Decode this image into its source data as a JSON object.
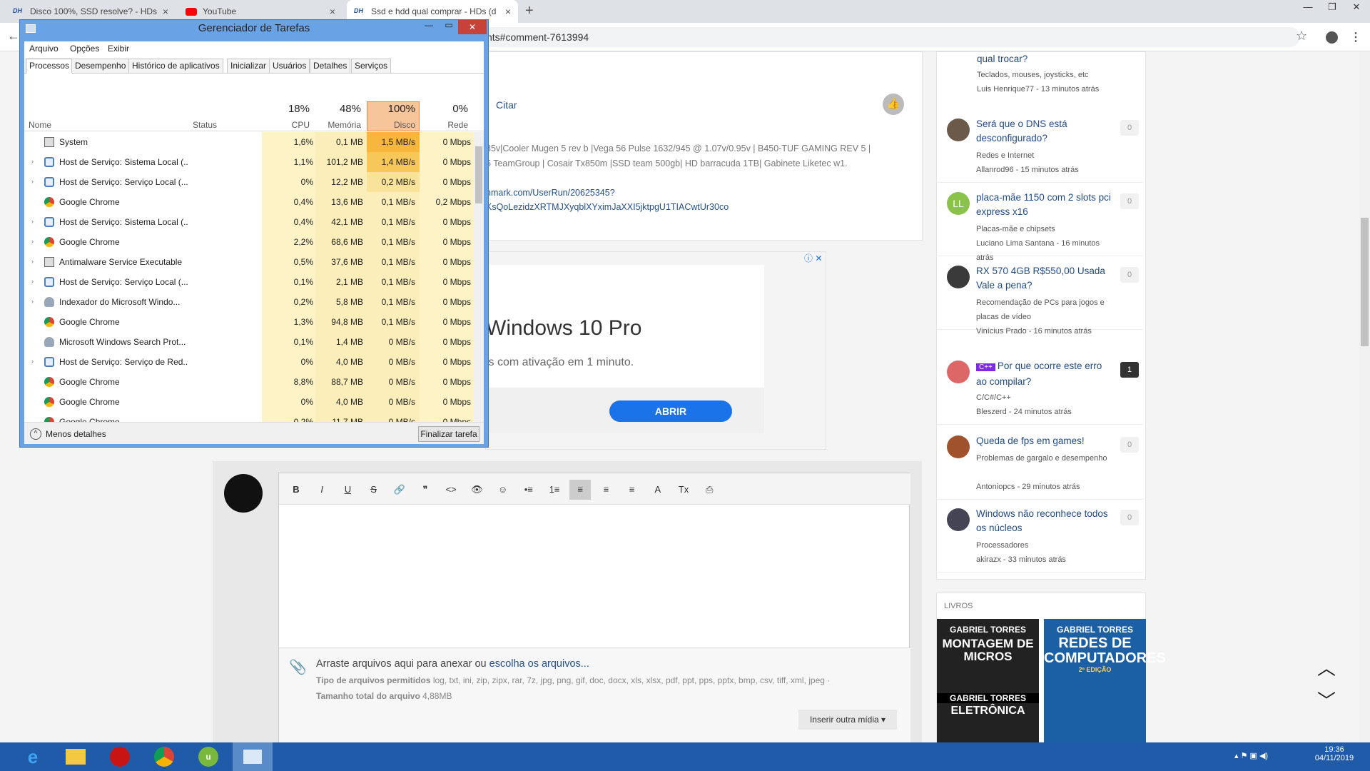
{
  "browser": {
    "tabs": [
      {
        "favicon": "DH",
        "title": "Disco 100%, SSD resolve? - HDs (",
        "close": "×"
      },
      {
        "favicon": "youtube-icon",
        "title": "YouTube",
        "close": "×"
      },
      {
        "favicon": "DH",
        "title": "Ssd e hdd qual comprar - HDs (d",
        "close": "×"
      }
    ],
    "new_tab": "+",
    "url": "nts#comment-7613994",
    "back": "←",
    "star": "☆",
    "menu": "⋮",
    "window_controls": [
      "—",
      "❐",
      "✕"
    ]
  },
  "post": {
    "cite": "Citar",
    "sig_line1": "35v|Cooler Mugen 5 rev b |Vega 56 Pulse 1632/945 @ 1.07v/0.95v | B450-TUF GAMING REV 5 |",
    "sig_line2": "5 TeamGroup | Cosair Tx850m |SSD team 500gb| HD barracuda 1TB| Gabinete Liketec w1.",
    "link1": "hmark.com/UserRun/20625345?",
    "link2": "KsQoLezidzXRTMJXyqblXYximJaXXI5jktpgU1TIACwtUr30co"
  },
  "ad": {
    "title": "Windows 10 Pro",
    "subtitle": "is com ativação em 1 minuto.",
    "button": "ABRIR",
    "info": "ⓘ ✕"
  },
  "sidebar": {
    "first_title": "qual trocar?",
    "first_forum": "Teclados, mouses, joysticks, etc",
    "first_meta": "Luis Henrique77 - 13 minutos atrás",
    "items": [
      {
        "title": "Será que o DNS está desconfigurado?",
        "forum": "Redes e Internet",
        "meta": "Allanrod96 - 15 minutos atrás",
        "count": "0",
        "avatar": ""
      },
      {
        "title": "placa-mãe 1150 com 2 slots pci express x16",
        "forum": "Placas-mãe e chipsets",
        "meta": "Luciano Lima Santana - 16 minutos atrás",
        "count": "0",
        "avatar": "LL"
      },
      {
        "title": "RX 570 4GB R$550,00 Usada Vale a pena?",
        "forum": "Recomendação de PCs para jogos e placas de vídeo",
        "meta": "Vinícius Prado - 16 minutos atrás",
        "count": "0",
        "avatar": ""
      },
      {
        "title": "Por que ocorre este erro ao compilar?",
        "tag": "C++",
        "forum": "C/C#/C++",
        "meta": "Bleszerd - 24 minutos atrás",
        "count": "1",
        "avatar": ""
      },
      {
        "title": "Queda de fps em games!",
        "forum": "Problemas de gargalo e desempenho",
        "meta": "Antoniopcs - 29 minutos atrás",
        "count": "0",
        "avatar": ""
      },
      {
        "title": "Windows não reconhece todos os núcleos",
        "forum": "Processadores",
        "meta": "akirazx - 33 minutos atrás",
        "count": "0",
        "avatar": ""
      }
    ],
    "books_label": "LIVROS",
    "book1_author": "GABRIEL TORRES",
    "book1_title": "MONTAGEM DE MICROS",
    "book2_author": "GABRIEL TORRES",
    "book2_title": "REDES DE COMPUTADORES",
    "book2_ed": "2ª EDIÇÃO",
    "book3_author": "GABRIEL TORRES",
    "book3_title": "ELETRÔNICA"
  },
  "editor": {
    "toolbar": [
      "B",
      "I",
      "U",
      "S",
      "🔗",
      "❞",
      "<>",
      "👁",
      "☺",
      "•≡",
      "1≡",
      "≡",
      "≡",
      "≡",
      "A",
      "Tx",
      "⎙"
    ],
    "attach_text": "Arraste arquivos aqui para anexar ou ",
    "attach_link": "escolha os arquivos...",
    "types_label": "Tipo de arquivos permitidos",
    "types": "log, txt, ini, zip, zipx, rar, 7z, jpg, png, gif, doc, docx, xls, xlsx, pdf, ppt, pps, pptx, bmp, csv, tiff, xml, jpeg ·",
    "size_label": "Tamanho total do arquivo",
    "size": "4,88MB",
    "media_button": "Inserir outra mídia ▾"
  },
  "nav_arrows": {
    "up": "︿",
    "down": "﹀"
  },
  "taskmgr": {
    "title": "Gerenciador de Tarefas",
    "controls": [
      "—",
      "▭",
      "✕"
    ],
    "menu": [
      "Arquivo",
      "Opções",
      "Exibir"
    ],
    "tabs": [
      "Processos",
      "Desempenho",
      "Histórico de aplicativos",
      "Inicializar",
      "Usuários",
      "Detalhes",
      "Serviços"
    ],
    "col_name": "Nome",
    "col_status": "Status",
    "cpu_pct": "18%",
    "cpu_label": "CPU",
    "mem_pct": "48%",
    "mem_label": "Memória",
    "disk_pct": "100%",
    "disk_label": "Disco",
    "net_pct": "0%",
    "net_label": "Rede",
    "rows": [
      {
        "name": "System",
        "icon": "system-icon",
        "expand": false,
        "cpu": "1,6%",
        "mem": "0,1 MB",
        "disk": "1,5 MB/s",
        "net": "0 Mbps"
      },
      {
        "name": "Host de Serviço: Sistema Local (...",
        "icon": "gear-icon",
        "expand": true,
        "cpu": "1,1%",
        "mem": "101,2 MB",
        "disk": "1,4 MB/s",
        "net": "0 Mbps"
      },
      {
        "name": "Host de Serviço: Serviço Local (...",
        "icon": "gear-icon",
        "expand": true,
        "cpu": "0%",
        "mem": "12,2 MB",
        "disk": "0,2 MB/s",
        "net": "0 Mbps"
      },
      {
        "name": "Google Chrome",
        "icon": "chrome-icon",
        "expand": false,
        "cpu": "0,4%",
        "mem": "13,6 MB",
        "disk": "0,1 MB/s",
        "net": "0,2 Mbps"
      },
      {
        "name": "Host de Serviço: Sistema Local (...",
        "icon": "gear-icon",
        "expand": true,
        "cpu": "0,4%",
        "mem": "42,1 MB",
        "disk": "0,1 MB/s",
        "net": "0 Mbps"
      },
      {
        "name": "Google Chrome",
        "icon": "chrome-icon",
        "expand": true,
        "cpu": "2,2%",
        "mem": "68,6 MB",
        "disk": "0,1 MB/s",
        "net": "0 Mbps"
      },
      {
        "name": "Antimalware Service Executable",
        "icon": "system-icon",
        "expand": true,
        "cpu": "0,5%",
        "mem": "37,6 MB",
        "disk": "0,1 MB/s",
        "net": "0 Mbps"
      },
      {
        "name": "Host de Serviço: Serviço Local (...",
        "icon": "gear-icon",
        "expand": true,
        "cpu": "0,1%",
        "mem": "2,1 MB",
        "disk": "0,1 MB/s",
        "net": "0 Mbps"
      },
      {
        "name": "Indexador do Microsoft Windo...",
        "icon": "user-icon",
        "expand": true,
        "cpu": "0,2%",
        "mem": "5,8 MB",
        "disk": "0,1 MB/s",
        "net": "0 Mbps"
      },
      {
        "name": "Google Chrome",
        "icon": "chrome-icon",
        "expand": false,
        "cpu": "1,3%",
        "mem": "94,8 MB",
        "disk": "0,1 MB/s",
        "net": "0 Mbps"
      },
      {
        "name": "Microsoft Windows Search Prot...",
        "icon": "user-icon",
        "expand": false,
        "cpu": "0,1%",
        "mem": "1,4 MB",
        "disk": "0 MB/s",
        "net": "0 Mbps"
      },
      {
        "name": "Host de Serviço: Serviço de Red...",
        "icon": "gear-icon",
        "expand": true,
        "cpu": "0%",
        "mem": "4,0 MB",
        "disk": "0 MB/s",
        "net": "0 Mbps"
      },
      {
        "name": "Google Chrome",
        "icon": "chrome-icon",
        "expand": false,
        "cpu": "8,8%",
        "mem": "88,7 MB",
        "disk": "0 MB/s",
        "net": "0 Mbps"
      },
      {
        "name": "Google Chrome",
        "icon": "chrome-icon",
        "expand": false,
        "cpu": "0%",
        "mem": "4,0 MB",
        "disk": "0 MB/s",
        "net": "0 Mbps"
      },
      {
        "name": "Google Chrome",
        "icon": "chrome-icon",
        "expand": false,
        "cpu": "0,2%",
        "mem": "11,7 MB",
        "disk": "0 MB/s",
        "net": "0 Mbps"
      }
    ],
    "less_details": "Menos detalhes",
    "end_task": "Finalizar tarefa"
  },
  "taskbar": {
    "time": "19:36",
    "date": "04/11/2019"
  }
}
